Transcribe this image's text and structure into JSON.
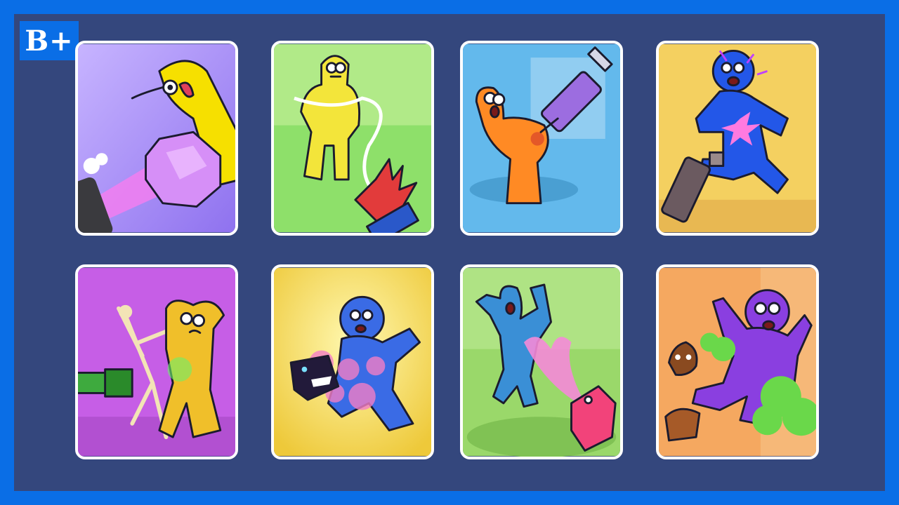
{
  "badge": {
    "text": "B+",
    "color": "#0a6ee6"
  },
  "colors": {
    "board": "#34477d",
    "frame": "#0a6ee6",
    "card_border": "#ffffff"
  },
  "cards": [
    {
      "icon": "gem-blast-icon",
      "figure_color": "#f6e000",
      "background": "#a88cf5"
    },
    {
      "icon": "web-sling-icon",
      "figure_color": "#f3e53a",
      "background": "#8ee06a"
    },
    {
      "icon": "syringe-icon",
      "figure_color": "#ff8a24",
      "background": "#63b9ec"
    },
    {
      "icon": "shock-gun-icon",
      "figure_color": "#2357e8",
      "background": "#f4d060"
    },
    {
      "icon": "skeleton-xray-icon",
      "figure_color": "#f0bf2a",
      "background": "#c65ee6"
    },
    {
      "icon": "monster-bite-icon",
      "figure_color": "#3a6be5",
      "background": "#f0d84a"
    },
    {
      "icon": "pink-spray-icon",
      "figure_color": "#3a8fd6",
      "background": "#9ad86a"
    },
    {
      "icon": "stink-cloud-icon",
      "figure_color": "#8a3fe0",
      "background": "#f5a860"
    }
  ]
}
